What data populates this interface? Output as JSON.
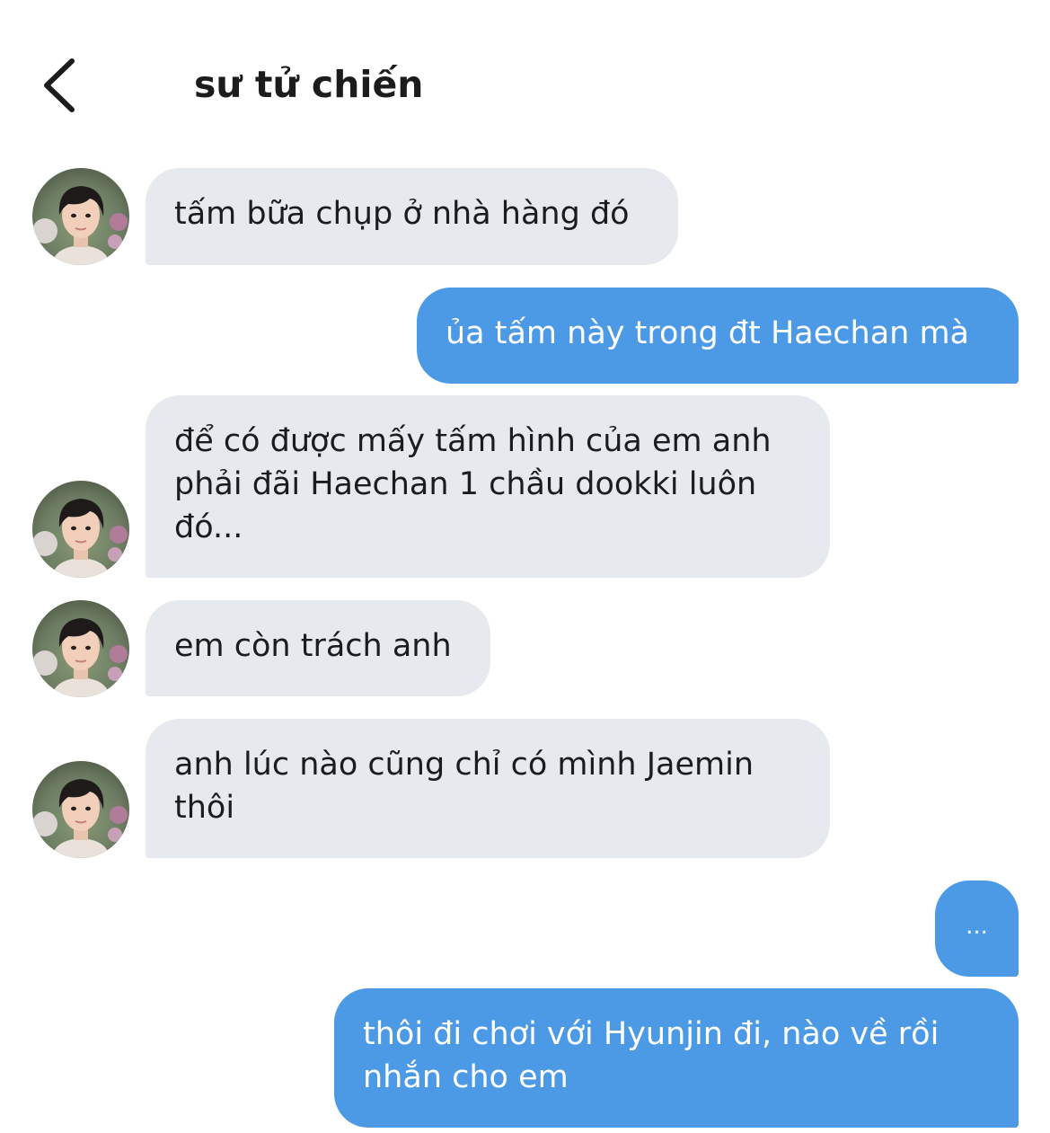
{
  "header": {
    "title": "sư tử chiến"
  },
  "icons": {
    "back": "chevron-left-icon",
    "avatar": "contact-avatar"
  },
  "colors": {
    "incoming_bubble": "#e6e9ed",
    "outgoing_bubble": "#4c9ae6",
    "title_text": "#1c1c1e"
  },
  "messages": [
    {
      "direction": "incoming",
      "text": "tấm bữa chụp ở nhà hàng đó"
    },
    {
      "direction": "outgoing",
      "text": "ủa tấm này trong đt Haechan mà"
    },
    {
      "direction": "incoming",
      "text": "để có được mấy tấm hình của em anh phải đãi Haechan 1 chầu dookki luôn đó..."
    },
    {
      "direction": "incoming",
      "text": "em còn trách anh"
    },
    {
      "direction": "incoming",
      "text": "anh lúc nào cũng chỉ có mình Jaemin thôi"
    },
    {
      "direction": "outgoing",
      "text": "..."
    },
    {
      "direction": "outgoing",
      "text": "thôi đi chơi với Hyunjin đi, nào về rồi nhắn cho em"
    }
  ]
}
